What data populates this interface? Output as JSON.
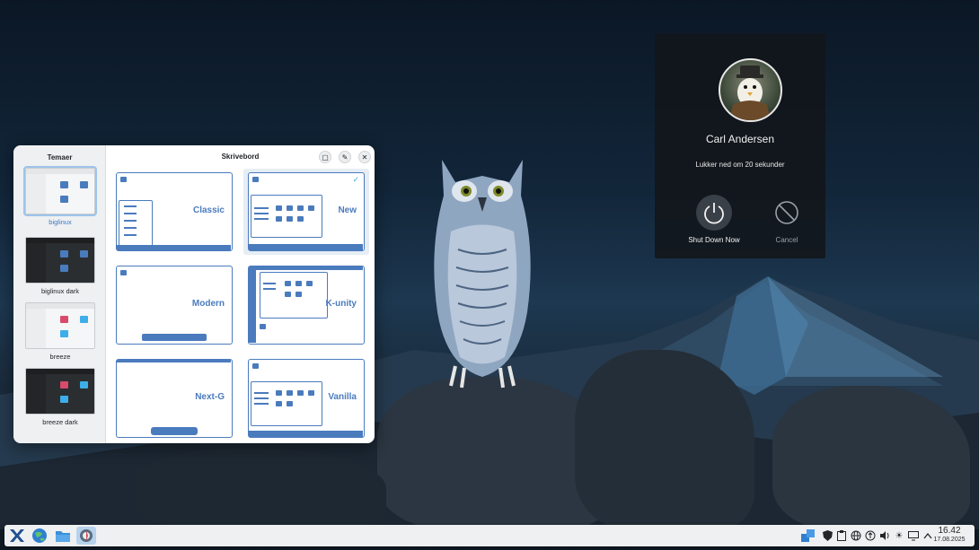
{
  "themes_window": {
    "sidebar_title": "Temaer",
    "themes": [
      {
        "name": "biglinux",
        "selected": true
      },
      {
        "name": "biglinux dark",
        "selected": false
      },
      {
        "name": "breeze",
        "selected": false
      },
      {
        "name": "breeze dark",
        "selected": false
      }
    ],
    "main_title": "Skrivebord",
    "layouts": [
      {
        "label": "Classic",
        "active": false
      },
      {
        "label": "New",
        "active": true
      },
      {
        "label": "Modern",
        "active": false
      },
      {
        "label": "K-unity",
        "active": false
      },
      {
        "label": "Next-G",
        "active": false
      },
      {
        "label": "Vanilla",
        "active": false
      }
    ],
    "accent_color": "#4a7bbd"
  },
  "logout_dialog": {
    "user_name": "Carl Andersen",
    "countdown": "Lukker ned om 20 sekunder",
    "actions": [
      {
        "label": "Shut Down Now",
        "icon": "power-icon"
      },
      {
        "label": "Cancel",
        "icon": "cancel-icon"
      }
    ]
  },
  "taskbar": {
    "launchers": [
      "biglinux-menu-icon",
      "browser-icon",
      "file-manager-icon",
      "theme-settings-icon"
    ],
    "tray": [
      "windows-icon",
      "shield-icon",
      "clipboard-icon",
      "network-icon",
      "vpn-icon",
      "volume-icon",
      "brightness-icon",
      "display-icon",
      "expand-tray-icon"
    ],
    "clock": {
      "time": "16.42",
      "date": "17.08.2025"
    }
  }
}
